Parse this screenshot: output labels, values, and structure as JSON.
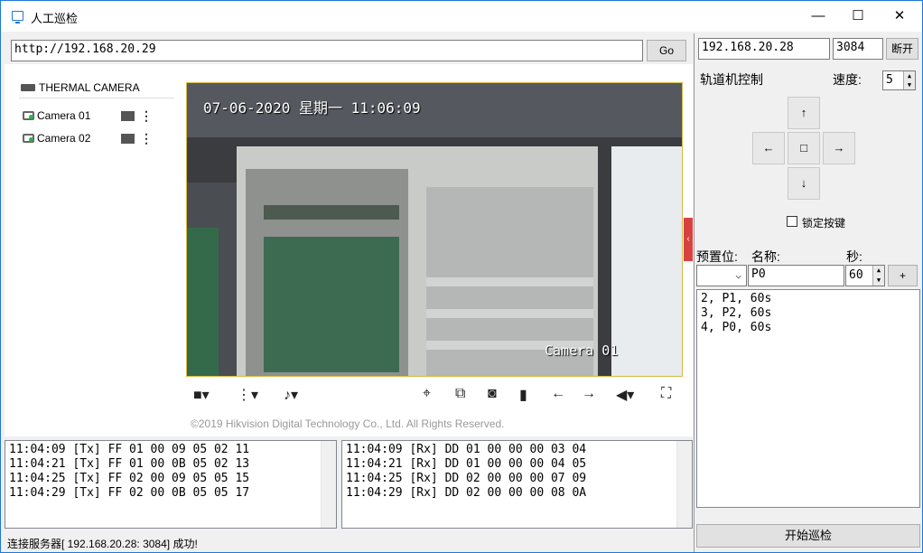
{
  "window": {
    "title": "人工巡检",
    "minimize": "—",
    "maximize": "☐",
    "close": "✕"
  },
  "browser": {
    "url": "http://192.168.20.29",
    "go_label": "Go"
  },
  "device_tree": {
    "device": "THERMAL CAMERA",
    "cameras": [
      {
        "label": "Camera 01"
      },
      {
        "label": "Camera 02"
      }
    ]
  },
  "video": {
    "timestamp": "07-06-2020 星期一 11:06:09",
    "channel_label": "Camera 01",
    "copyright": "©2019 Hikvision Digital Technology Co., Ltd. All Rights Reserved."
  },
  "log_tx": [
    "11:04:09 [Tx] FF 01 00 09 05 02 11",
    "11:04:21 [Tx] FF 01 00 0B 05 02 13",
    "11:04:25 [Tx] FF 02 00 09 05 05 15",
    "11:04:29 [Tx] FF 02 00 0B 05 05 17"
  ],
  "log_rx": [
    "11:04:09 [Rx] DD 01 00 00 00 03 04",
    "11:04:21 [Rx] DD 01 00 00 00 04 05",
    "11:04:25 [Rx] DD 02 00 00 00 07 09",
    "11:04:29 [Rx] DD 02 00 00 00 08 0A"
  ],
  "status": "连接服务器[ 192.168.20.28: 3084] 成功!",
  "server": {
    "ip": "192.168.20.28",
    "port": "3084",
    "disconnect_label": "断开"
  },
  "rail_control": {
    "title": "轨道机控制",
    "speed_label": "速度:",
    "speed_value": "5",
    "up": "↑",
    "down": "↓",
    "left": "←",
    "right": "→",
    "center": "□",
    "lock_label": "锁定按键"
  },
  "preset": {
    "preset_label": "预置位:",
    "name_label": "名称:",
    "seconds_label": "秒:",
    "name_value": "P0",
    "seconds_value": "60",
    "add_label": "+",
    "list": [
      "2, P1, 60s",
      "3, P2, 60s",
      "4, P0, 60s"
    ]
  },
  "start_button": "开始巡检"
}
